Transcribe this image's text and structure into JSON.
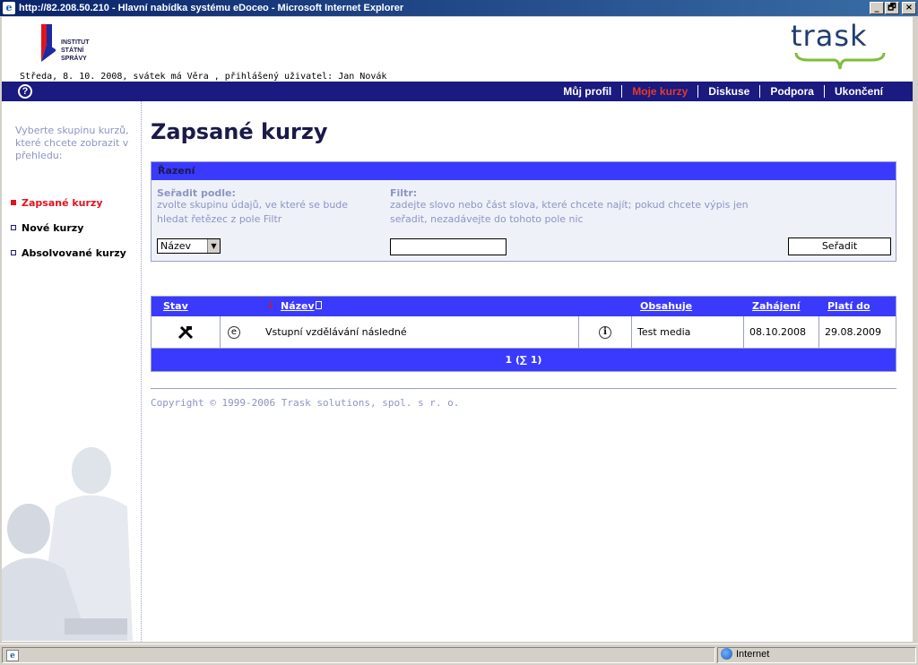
{
  "window": {
    "title": "http://82.208.50.210 - Hlavní nabídka systému eDoceo - Microsoft Internet Explorer",
    "buttons": [
      "_",
      "🗗",
      "×"
    ]
  },
  "header": {
    "isp_logo_text": [
      "INSTITUT",
      "STÁTNÍ",
      "SPRÁVY"
    ],
    "trask_logo": "trask",
    "date_line": "Středa, 8. 10. 2008, svátek má Věra , přihlášený uživatel: Jan Novák"
  },
  "nav": {
    "help": "?",
    "links": [
      "Můj profil",
      "Moje kurzy",
      "Diskuse",
      "Podpora",
      "Ukončení"
    ],
    "active": "Moje kurzy"
  },
  "sidebar": {
    "intro": "Vyberte skupinu kurzů, které chcete zobrazit v přehledu:",
    "items": [
      "Zapsané kurzy",
      "Nové kurzy",
      "Absolvované kurzy"
    ],
    "active": "Zapsané kurzy"
  },
  "main": {
    "title": "Zapsané kurzy",
    "sort": {
      "header": "Řazení",
      "sort_by_label": "Seřadit podle:",
      "sort_by_hint": "zvolte skupinu údajů, ve které se bude hledat řetězec z pole Filtr",
      "filter_label": "Filtr:",
      "filter_hint": "zadejte slovo nebo část slova, které chcete najít; pokud chcete výpis jen seřadit, nezadávejte do tohoto pole nic",
      "select_value": "Název",
      "filter_value": "",
      "button": "Seřadit"
    },
    "table": {
      "headers": [
        "Stav",
        "Název",
        "Obsahuje",
        "Zahájení",
        "Platí do"
      ],
      "rows": [
        {
          "name": "Vstupní vzdělávání následné",
          "contains": "Test  media",
          "start": "08.10.2008",
          "valid_to": "29.08.2009"
        }
      ],
      "pagination": "1 (∑ 1)"
    },
    "copyright": "Copyright © 1999-2006 Trask solutions, spol. s r. o."
  },
  "statusbar": {
    "zone": "Internet"
  }
}
